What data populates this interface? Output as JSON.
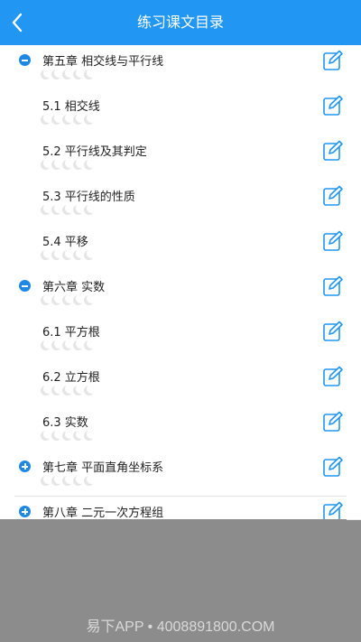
{
  "header": {
    "title": "练习课文目录",
    "back_icon": "chevron-left-icon"
  },
  "colors": {
    "accent": "#2196f3",
    "toggle": "#1e88e5",
    "overlay": "#8c8c8c"
  },
  "list": {
    "items": [
      {
        "label": "第五章 相交线与平行线",
        "type": "chapter",
        "toggle": "collapse"
      },
      {
        "label": "5.1 相交线",
        "type": "section"
      },
      {
        "label": "5.2 平行线及其判定",
        "type": "section"
      },
      {
        "label": "5.3 平行线的性质",
        "type": "section"
      },
      {
        "label": "5.4 平移",
        "type": "section"
      },
      {
        "label": "第六章 实数",
        "type": "chapter",
        "toggle": "collapse"
      },
      {
        "label": "6.1 平方根",
        "type": "section"
      },
      {
        "label": "6.2 立方根",
        "type": "section"
      },
      {
        "label": "6.3 实数",
        "type": "section"
      },
      {
        "label": "第七章 平面直角坐标系",
        "type": "chapter",
        "toggle": "expand"
      },
      {
        "label": "第八章 二元一次方程组",
        "type": "chapter",
        "toggle": "expand"
      }
    ],
    "stars_per_item": 5
  },
  "watermark": "易下APP • 4008891800.COM"
}
